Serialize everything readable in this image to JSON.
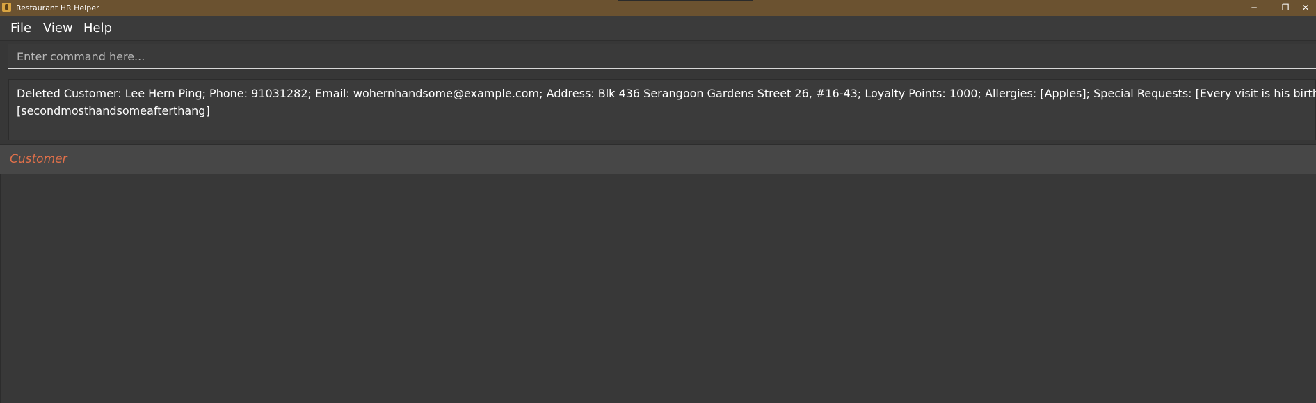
{
  "window": {
    "title": "Restaurant HR Helper",
    "icon": "restaurant-app-icon",
    "controls": {
      "minimize": "─",
      "maximize": "❐",
      "close": "✕"
    }
  },
  "menu": {
    "items": [
      "File",
      "View",
      "Help"
    ]
  },
  "command": {
    "placeholder": "Enter command here...",
    "value": ""
  },
  "result": {
    "line1": "Deleted Customer: Lee Hern Ping; Phone: 91031282; Email: wohernhandsome@example.com; Address: Blk 436 Serangoon Gardens Street 26, #16-43; Loyalty Points: 1000; Allergies: [Apples]; Special Requests: [Every visit is his birthday]; Tags:",
    "line2": "[secondmosthandsomeafterthang]"
  },
  "list": {
    "title": "Customer",
    "items": []
  },
  "colors": {
    "titlebar": "#6b5230",
    "background": "#373737",
    "accent": "#e0704a"
  }
}
